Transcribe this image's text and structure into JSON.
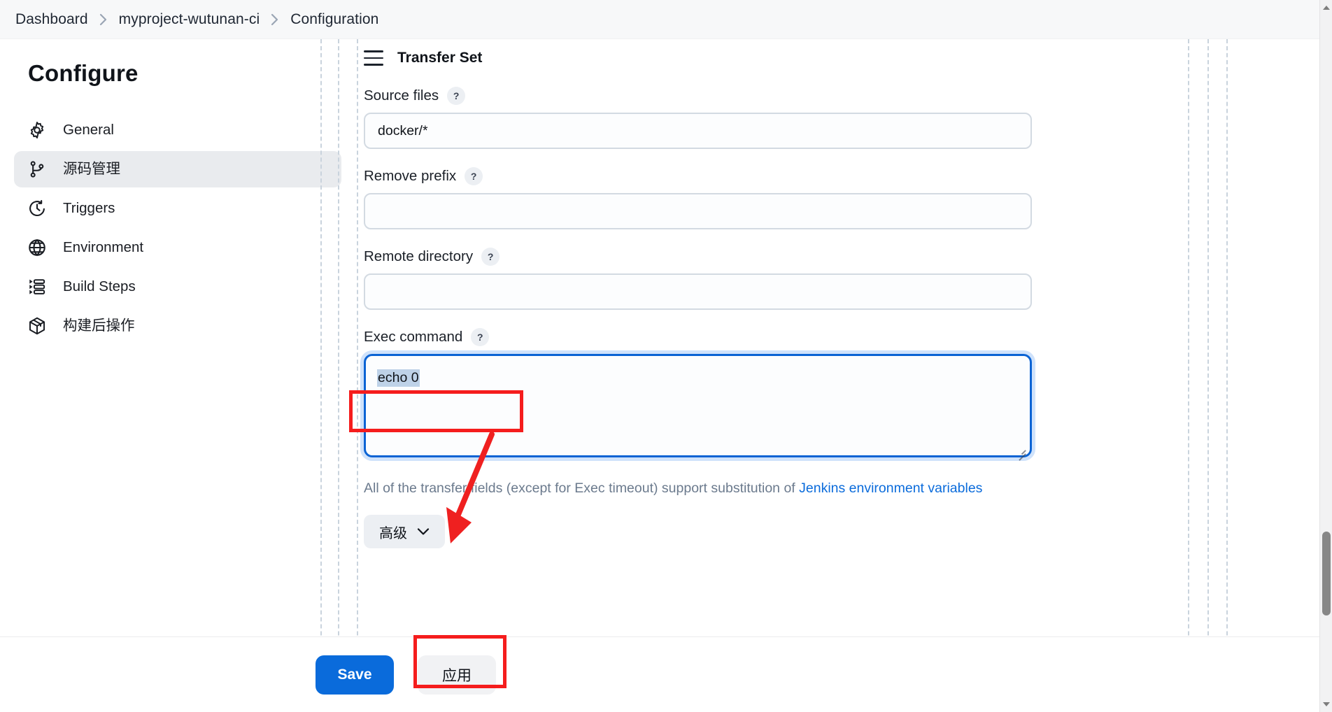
{
  "breadcrumb": {
    "items": [
      {
        "label": "Dashboard"
      },
      {
        "label": "myproject-wutunan-ci"
      },
      {
        "label": "Configuration"
      }
    ],
    "separator_icon": "chevron-right-icon"
  },
  "sidebar": {
    "title": "Configure",
    "items": [
      {
        "label": "General",
        "icon": "gear-icon",
        "active": false
      },
      {
        "label": "源码管理",
        "icon": "source-branch-icon",
        "active": true
      },
      {
        "label": "Triggers",
        "icon": "clock-icon",
        "active": false
      },
      {
        "label": "Environment",
        "icon": "globe-icon",
        "active": false
      },
      {
        "label": "Build Steps",
        "icon": "list-steps-icon",
        "active": false
      },
      {
        "label": "构建后操作",
        "icon": "package-box-icon",
        "active": false
      }
    ]
  },
  "main": {
    "section_title": "Transfer Set",
    "drag_handle_icon": "drag-handle-icon",
    "help_icon_label": "?",
    "fields": [
      {
        "label": "Source files",
        "value": "docker/*",
        "placeholder": "",
        "type": "text"
      },
      {
        "label": "Remove prefix",
        "value": "",
        "placeholder": "",
        "type": "text"
      },
      {
        "label": "Remote directory",
        "value": "",
        "placeholder": "",
        "type": "text"
      },
      {
        "label": "Exec command",
        "value": "echo 0",
        "placeholder": "",
        "type": "textarea",
        "focused": true,
        "selected_text": "echo 0"
      }
    ],
    "note": {
      "text_before": "All of the transfer fields (except for Exec timeout) support substitution of ",
      "link_text": "Jenkins environment variables"
    },
    "advanced_button": {
      "label": "高级",
      "icon": "chevron-down-icon"
    }
  },
  "footer": {
    "save_label": "Save",
    "apply_label": "应用"
  },
  "scrollbar": {
    "up_icon": "triangle-up-icon",
    "down_icon": "triangle-down-icon"
  },
  "annotations": {
    "exec_box": "red-highlight-box",
    "apply_box": "red-highlight-box",
    "arrow": "red-arrow-icon"
  },
  "colors": {
    "accent_blue": "#0a6bdb",
    "annotation_red": "#f51d1d",
    "sidebar_active": "#e9ebee",
    "selection_blue": "#bed2e8",
    "guide_line": "#c9d3dd"
  }
}
